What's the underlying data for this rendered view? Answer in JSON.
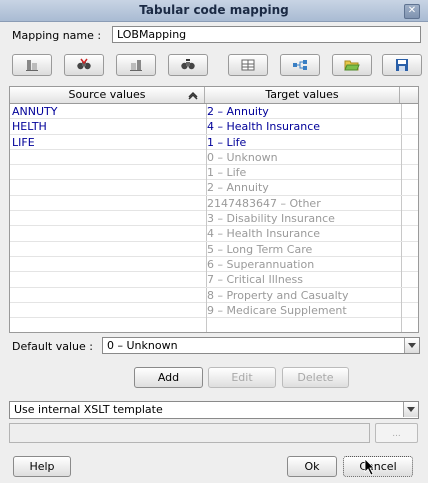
{
  "window": {
    "title": "Tabular code mapping"
  },
  "mapping": {
    "label": "Mapping name :",
    "value": "LOBMapping"
  },
  "toolbar": {
    "icons": [
      "tool-icon-1",
      "tool-icon-2",
      "tool-icon-3",
      "tool-icon-4",
      "tool-icon-5",
      "tool-icon-6",
      "tool-icon-7",
      "tool-icon-8"
    ]
  },
  "grid": {
    "headers": {
      "source": "Source values",
      "target": "Target values"
    },
    "rows": [
      {
        "source": "ANNUTY",
        "target": "2 – Annuity",
        "mapped": true
      },
      {
        "source": "HELTH",
        "target": "4 – Health Insurance",
        "mapped": true
      },
      {
        "source": "LIFE",
        "target": "1 – Life",
        "mapped": true
      },
      {
        "source": "",
        "target": "0 – Unknown",
        "mapped": false
      },
      {
        "source": "",
        "target": "1 – Life",
        "mapped": false
      },
      {
        "source": "",
        "target": "2 – Annuity",
        "mapped": false
      },
      {
        "source": "",
        "target": "2147483647 – Other",
        "mapped": false
      },
      {
        "source": "",
        "target": "3 – Disability Insurance",
        "mapped": false
      },
      {
        "source": "",
        "target": "4 – Health Insurance",
        "mapped": false
      },
      {
        "source": "",
        "target": "5 – Long Term Care",
        "mapped": false
      },
      {
        "source": "",
        "target": "6 – Superannuation",
        "mapped": false
      },
      {
        "source": "",
        "target": "7 – Critical Illness",
        "mapped": false
      },
      {
        "source": "",
        "target": "8 – Property and Casualty",
        "mapped": false
      },
      {
        "source": "",
        "target": "9 – Medicare Supplement",
        "mapped": false
      },
      {
        "source": "",
        "target": "",
        "mapped": false
      }
    ]
  },
  "default_value": {
    "label": "Default value :",
    "value": "0 – Unknown"
  },
  "buttons": {
    "add": "Add",
    "edit": "Edit",
    "delete": "Delete",
    "help": "Help",
    "ok": "Ok",
    "cancel": "Cancel",
    "browse": "..."
  },
  "template": {
    "value": "Use internal XSLT template"
  },
  "colors": {
    "mapped_text": "#000099",
    "unmapped_text": "#9a9a9a",
    "titlebar": "#b7c6db"
  }
}
